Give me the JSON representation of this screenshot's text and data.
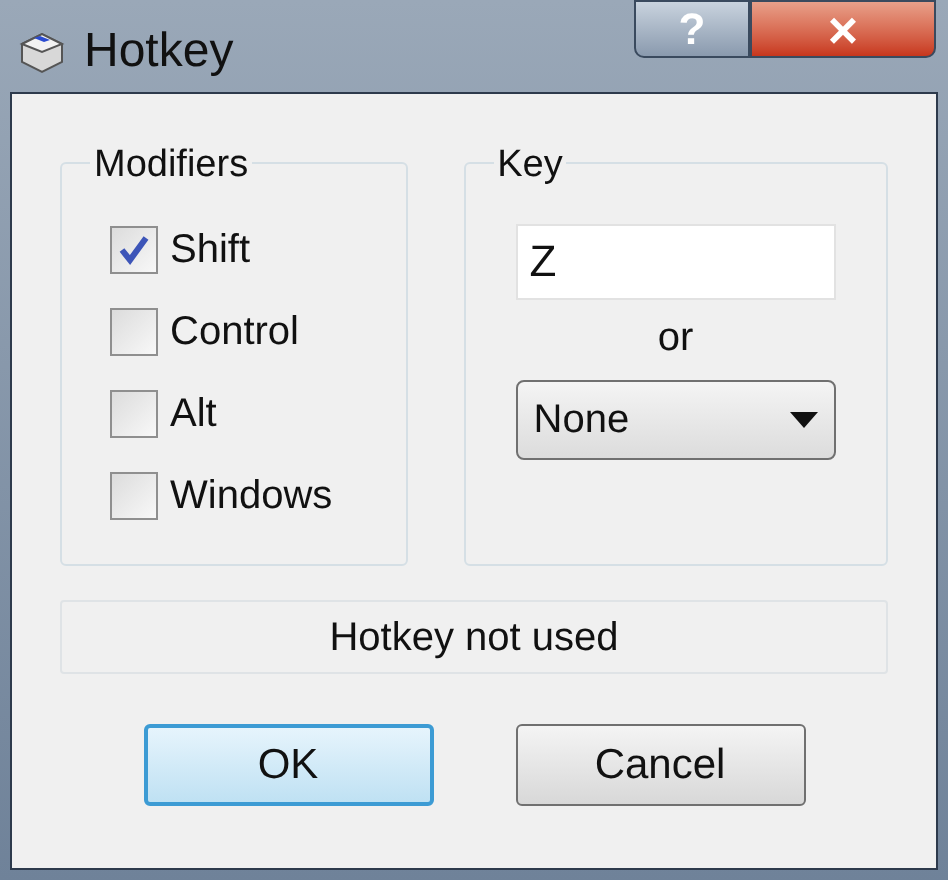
{
  "window": {
    "title": "Hotkey",
    "help_button": "?",
    "close_button": "×"
  },
  "modifiers": {
    "title": "Modifiers",
    "items": [
      {
        "label": "Shift",
        "checked": true
      },
      {
        "label": "Control",
        "checked": false
      },
      {
        "label": "Alt",
        "checked": false
      },
      {
        "label": "Windows",
        "checked": false
      }
    ]
  },
  "key": {
    "title": "Key",
    "value": "Z",
    "or": "or",
    "dropdown": "None"
  },
  "status": "Hotkey not used",
  "buttons": [
    {
      "label": "OK",
      "default": true
    },
    {
      "label": "Cancel",
      "default": false
    }
  ]
}
